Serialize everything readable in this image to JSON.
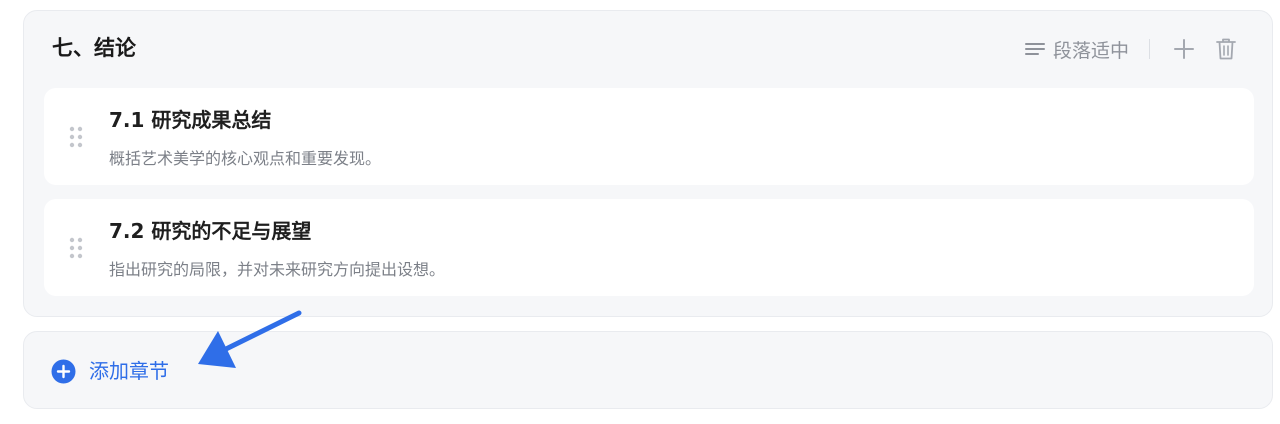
{
  "section": {
    "title": "七、结论",
    "density_label": "段落适中",
    "items": [
      {
        "title": "7.1 研究成果总结",
        "description": "概括艺术美学的核心观点和重要发现。"
      },
      {
        "title": "7.2 研究的不足与展望",
        "description": "指出研究的局限，并对未来研究方向提出设想。"
      }
    ]
  },
  "add_section": {
    "label": "添加章节"
  },
  "icons": {
    "density": "lines-icon",
    "add": "plus-icon",
    "delete": "trash-icon",
    "drag": "drag-handle-icon",
    "add_section": "plus-circle-icon",
    "annotation": "arrow-annotation"
  },
  "colors": {
    "accent": "#2f6ee8",
    "card_bg": "#f6f7f9",
    "muted": "#9a9ea6"
  }
}
